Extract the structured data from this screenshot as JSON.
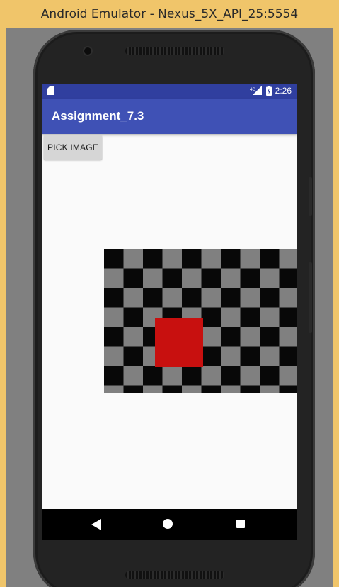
{
  "window": {
    "title": "Android Emulator - Nexus_5X_API_25:5554"
  },
  "status_bar": {
    "network": "4G",
    "time": "2:26"
  },
  "app_bar": {
    "title": "Assignment_7.3"
  },
  "main": {
    "pick_image_label": "PICK IMAGE"
  },
  "colors": {
    "status_bar": "#303f9f",
    "app_bar": "#3f51b5",
    "square": "#c8100f",
    "frame": "#f0c56a"
  },
  "icons": [
    "sd-card-icon",
    "signal-icon",
    "battery-icon",
    "back-icon",
    "home-icon",
    "recents-icon"
  ]
}
